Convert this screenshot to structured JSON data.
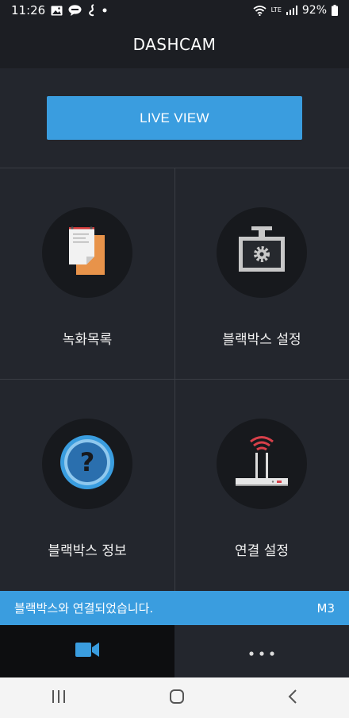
{
  "status_bar": {
    "time": "11:26",
    "network": "LTE",
    "battery": "92%"
  },
  "header": {
    "title": "DASHCAM"
  },
  "live_view": {
    "label": "LIVE VIEW"
  },
  "menu": [
    {
      "label": "녹화목록",
      "icon": "document-list-icon"
    },
    {
      "label": "블랙박스 설정",
      "icon": "dashcam-settings-icon"
    },
    {
      "label": "블랙박스 정보",
      "icon": "question-icon"
    },
    {
      "label": "연결 설정",
      "icon": "router-wifi-icon"
    }
  ],
  "toast": {
    "message": "블랙박스와 연결되었습니다.",
    "model": "M3"
  },
  "colors": {
    "accent": "#3a9ddf",
    "background": "#23262d",
    "header": "#1c1e23"
  }
}
